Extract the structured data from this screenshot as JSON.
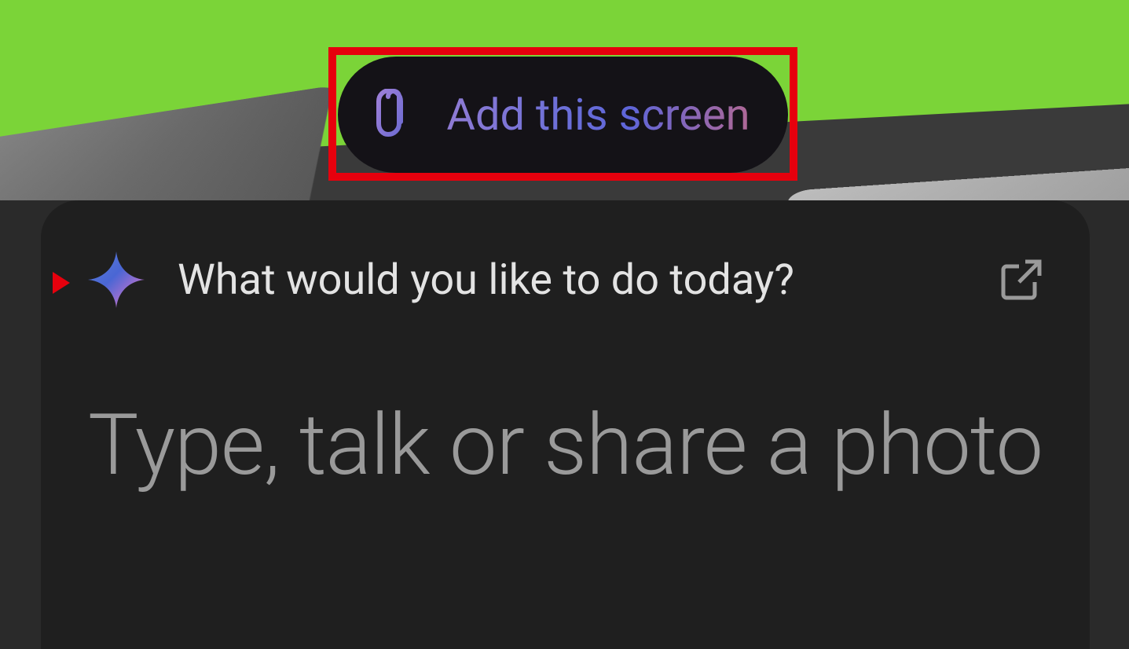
{
  "pill": {
    "label": "Add this screen"
  },
  "assistant": {
    "prompt": "What would you like to do today?",
    "input_placeholder": "Type, talk or share a photo"
  }
}
